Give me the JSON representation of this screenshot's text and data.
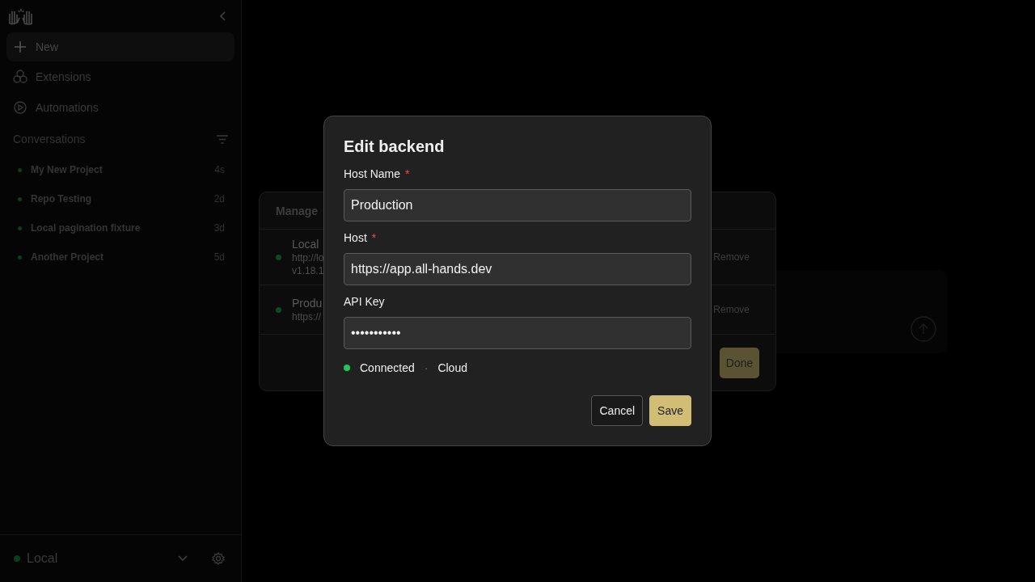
{
  "sidebar": {
    "new_label": "New",
    "nav": [
      {
        "kind": "extensions",
        "label": "Extensions"
      },
      {
        "kind": "automations",
        "label": "Automations"
      }
    ],
    "section_title": "Conversations",
    "conversations": [
      {
        "title": "My New Project",
        "time": "4s"
      },
      {
        "title": "Repo Testing",
        "time": "2d"
      },
      {
        "title": "Local pagination fixture",
        "time": "3d"
      },
      {
        "title": "Another Project",
        "time": "5d"
      }
    ],
    "backend": {
      "label": "Local",
      "connected": true
    }
  },
  "manage_dialog": {
    "title": "Manage",
    "backends": [
      {
        "name": "Local",
        "lines": [
          "http://lo",
          "v1.18.1"
        ],
        "action": "Remove"
      },
      {
        "name": "Produ",
        "lines": [
          "https://"
        ],
        "action": "Remove"
      }
    ],
    "done": "Done"
  },
  "edit_dialog": {
    "title": "Edit backend",
    "fields": [
      {
        "label": "Host Name",
        "marker": "*",
        "value": "Production"
      },
      {
        "label": "Host",
        "marker": "*",
        "value": "https://app.all-hands.dev"
      },
      {
        "label": "API Key",
        "value": "•••••••••••"
      }
    ],
    "status": {
      "connected": true,
      "state": "Connected",
      "separator": "·",
      "type": "Cloud"
    },
    "buttons": [
      {
        "kind": "secondary",
        "label": "Cancel"
      },
      {
        "kind": "primary",
        "label": "Save"
      }
    ]
  }
}
